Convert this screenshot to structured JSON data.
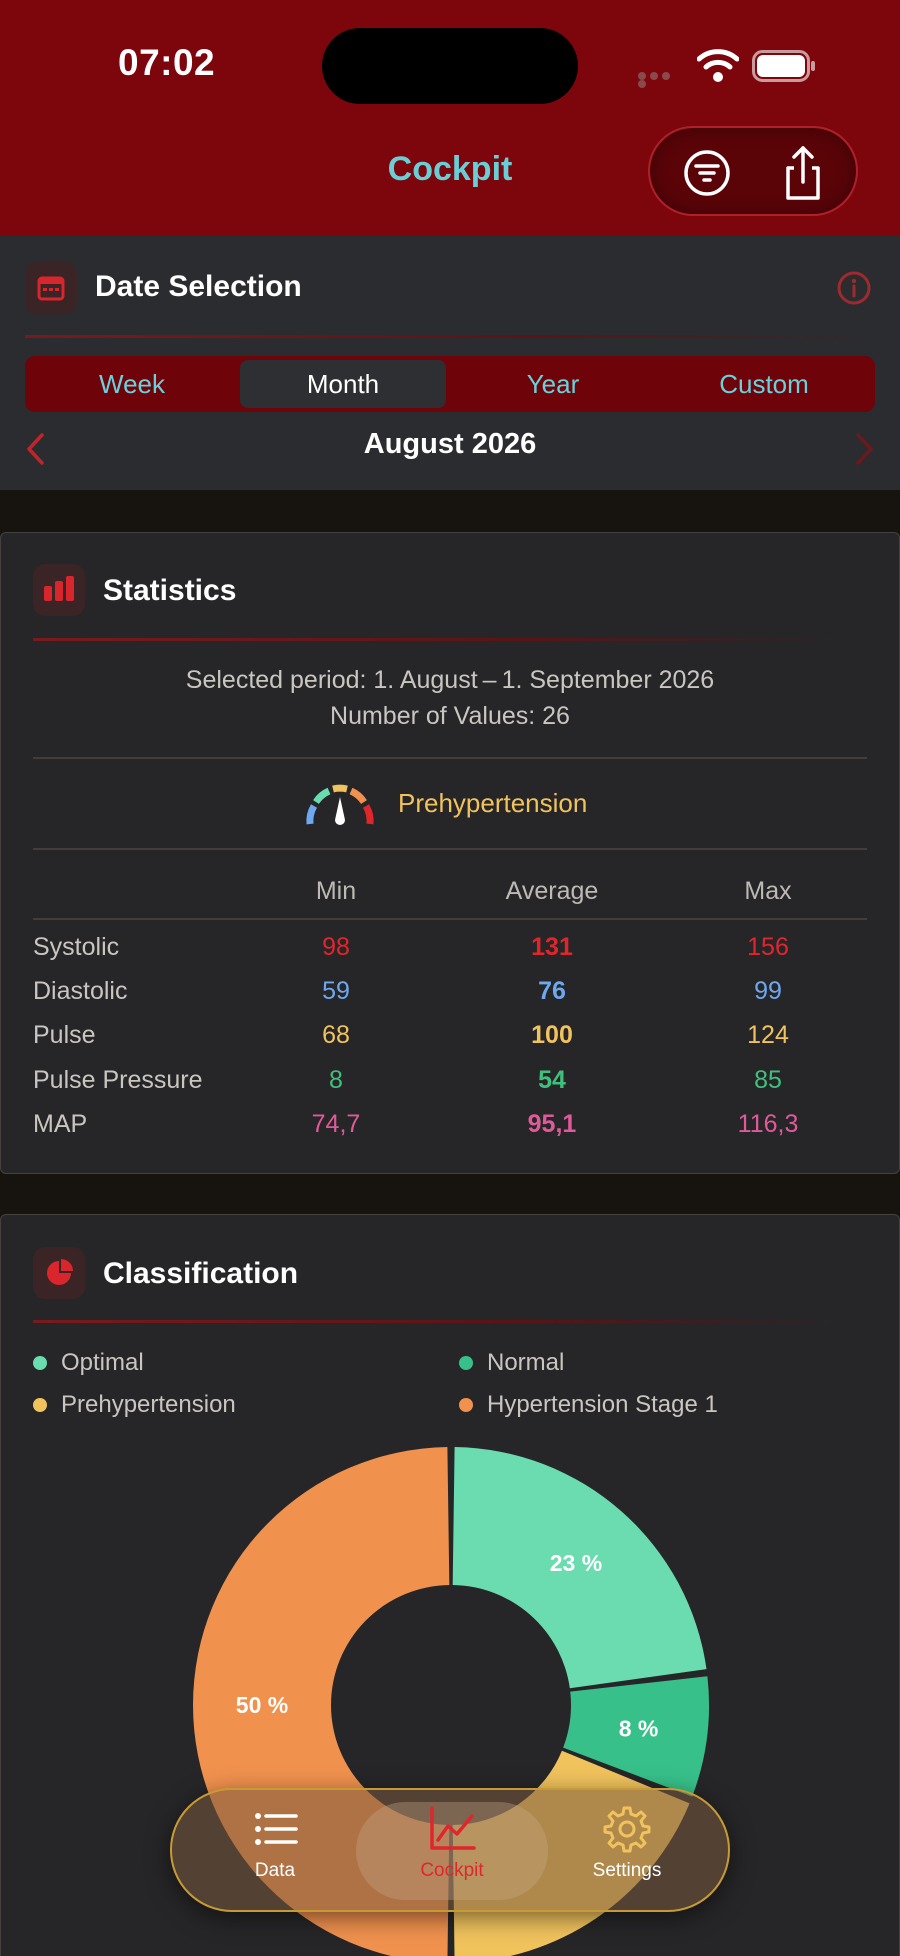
{
  "status_bar": {
    "time": "07:02"
  },
  "nav": {
    "title": "Cockpit",
    "filter_icon": "filter-icon",
    "share_icon": "share-icon"
  },
  "date_selection": {
    "title": "Date Selection",
    "segments": [
      "Week",
      "Month",
      "Year",
      "Custom"
    ],
    "selected_segment": "Month",
    "period": "August 2026"
  },
  "statistics": {
    "title": "Statistics",
    "selected_period": "Selected period: 1. August – 1. September 2026",
    "number_of_values": "Number of Values: 26",
    "classification": "Prehypertension",
    "headers": {
      "min": "Min",
      "average": "Average",
      "max": "Max"
    },
    "rows": [
      {
        "label": "Systolic",
        "min": "98",
        "average": "131",
        "max": "156",
        "color": "#e0262c"
      },
      {
        "label": "Diastolic",
        "min": "59",
        "average": "76",
        "max": "99",
        "color": "#6ea8ee"
      },
      {
        "label": "Pulse",
        "min": "68",
        "average": "100",
        "max": "124",
        "color": "#f1c35d"
      },
      {
        "label": "Pulse Pressure",
        "min": "8",
        "average": "54",
        "max": "85",
        "color": "#3fc07c"
      },
      {
        "label": "MAP",
        "min": "74,7",
        "average": "95,1",
        "max": "116,3",
        "color": "#e05a9a"
      }
    ]
  },
  "classification": {
    "title": "Classification",
    "legend": [
      {
        "label": "Optimal",
        "color": "#6bdbb0"
      },
      {
        "label": "Normal",
        "color": "#38c08a"
      },
      {
        "label": "Prehypertension",
        "color": "#f1c35d"
      },
      {
        "label": "Hypertension Stage 1",
        "color": "#f0914e"
      }
    ]
  },
  "chart_data": {
    "type": "pie",
    "categories": [
      "Optimal",
      "Normal",
      "Prehypertension",
      "Hypertension Stage 1"
    ],
    "values": [
      23,
      8,
      19,
      50
    ],
    "value_labels": [
      "23 %",
      "8 %",
      "",
      "50 %"
    ],
    "colors": [
      "#6bdbb0",
      "#38c08a",
      "#f1c35d",
      "#f0914e"
    ]
  },
  "tabbar": {
    "tabs": [
      {
        "label": "Data",
        "icon": "list-icon"
      },
      {
        "label": "Cockpit",
        "icon": "chart-line-icon"
      },
      {
        "label": "Settings",
        "icon": "gear-icon"
      }
    ],
    "active": "Cockpit",
    "accent_color": "#e0262c"
  }
}
